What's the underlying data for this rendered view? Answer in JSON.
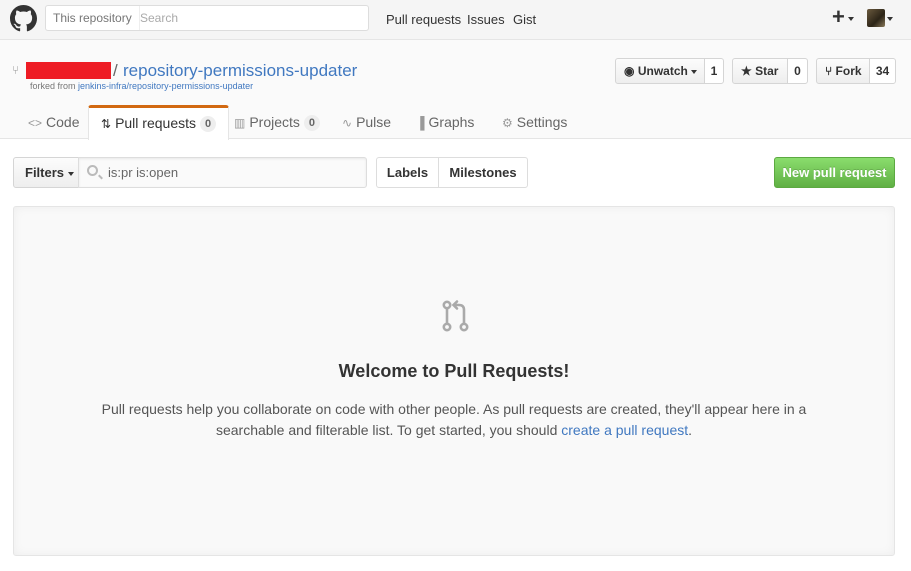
{
  "header": {
    "scope_label": "This repository",
    "search_placeholder": "Search",
    "nav": [
      "Pull requests",
      "Issues",
      "Gist"
    ],
    "plus_label": "+"
  },
  "repo": {
    "owner_redacted": true,
    "separator": "/",
    "name": "repository-permissions-updater",
    "forked_prefix": "forked from",
    "forked_from": "jenkins-infra/repository-permissions-updater"
  },
  "actions": {
    "watch_label": "Unwatch",
    "watch_count": "1",
    "star_label": "Star",
    "star_count": "0",
    "fork_label": "Fork",
    "fork_count": "34"
  },
  "tabs": [
    {
      "label": "Code",
      "icon": "code-icon"
    },
    {
      "label": "Pull requests",
      "icon": "git-pull-request-icon",
      "count": "0",
      "selected": true
    },
    {
      "label": "Projects",
      "icon": "project-icon",
      "count": "0"
    },
    {
      "label": "Pulse",
      "icon": "pulse-icon"
    },
    {
      "label": "Graphs",
      "icon": "graph-icon"
    },
    {
      "label": "Settings",
      "icon": "gear-icon"
    }
  ],
  "filterbar": {
    "filters_label": "Filters",
    "query": "is:pr is:open",
    "labels_label": "Labels",
    "milestones_label": "Milestones",
    "new_pr_label": "New pull request"
  },
  "blankslate": {
    "title": "Welcome to Pull Requests!",
    "body_1": "Pull requests help you collaborate on code with other people. As pull requests are created, they'll appear here in a searchable and filterable list. To get started, you should ",
    "link": "create a pull request",
    "body_2": "."
  },
  "colors": {
    "link": "#4078c0",
    "tab_accent": "#d26911",
    "new_pr_green": "#60b044",
    "redaction": "#ee1c25"
  }
}
